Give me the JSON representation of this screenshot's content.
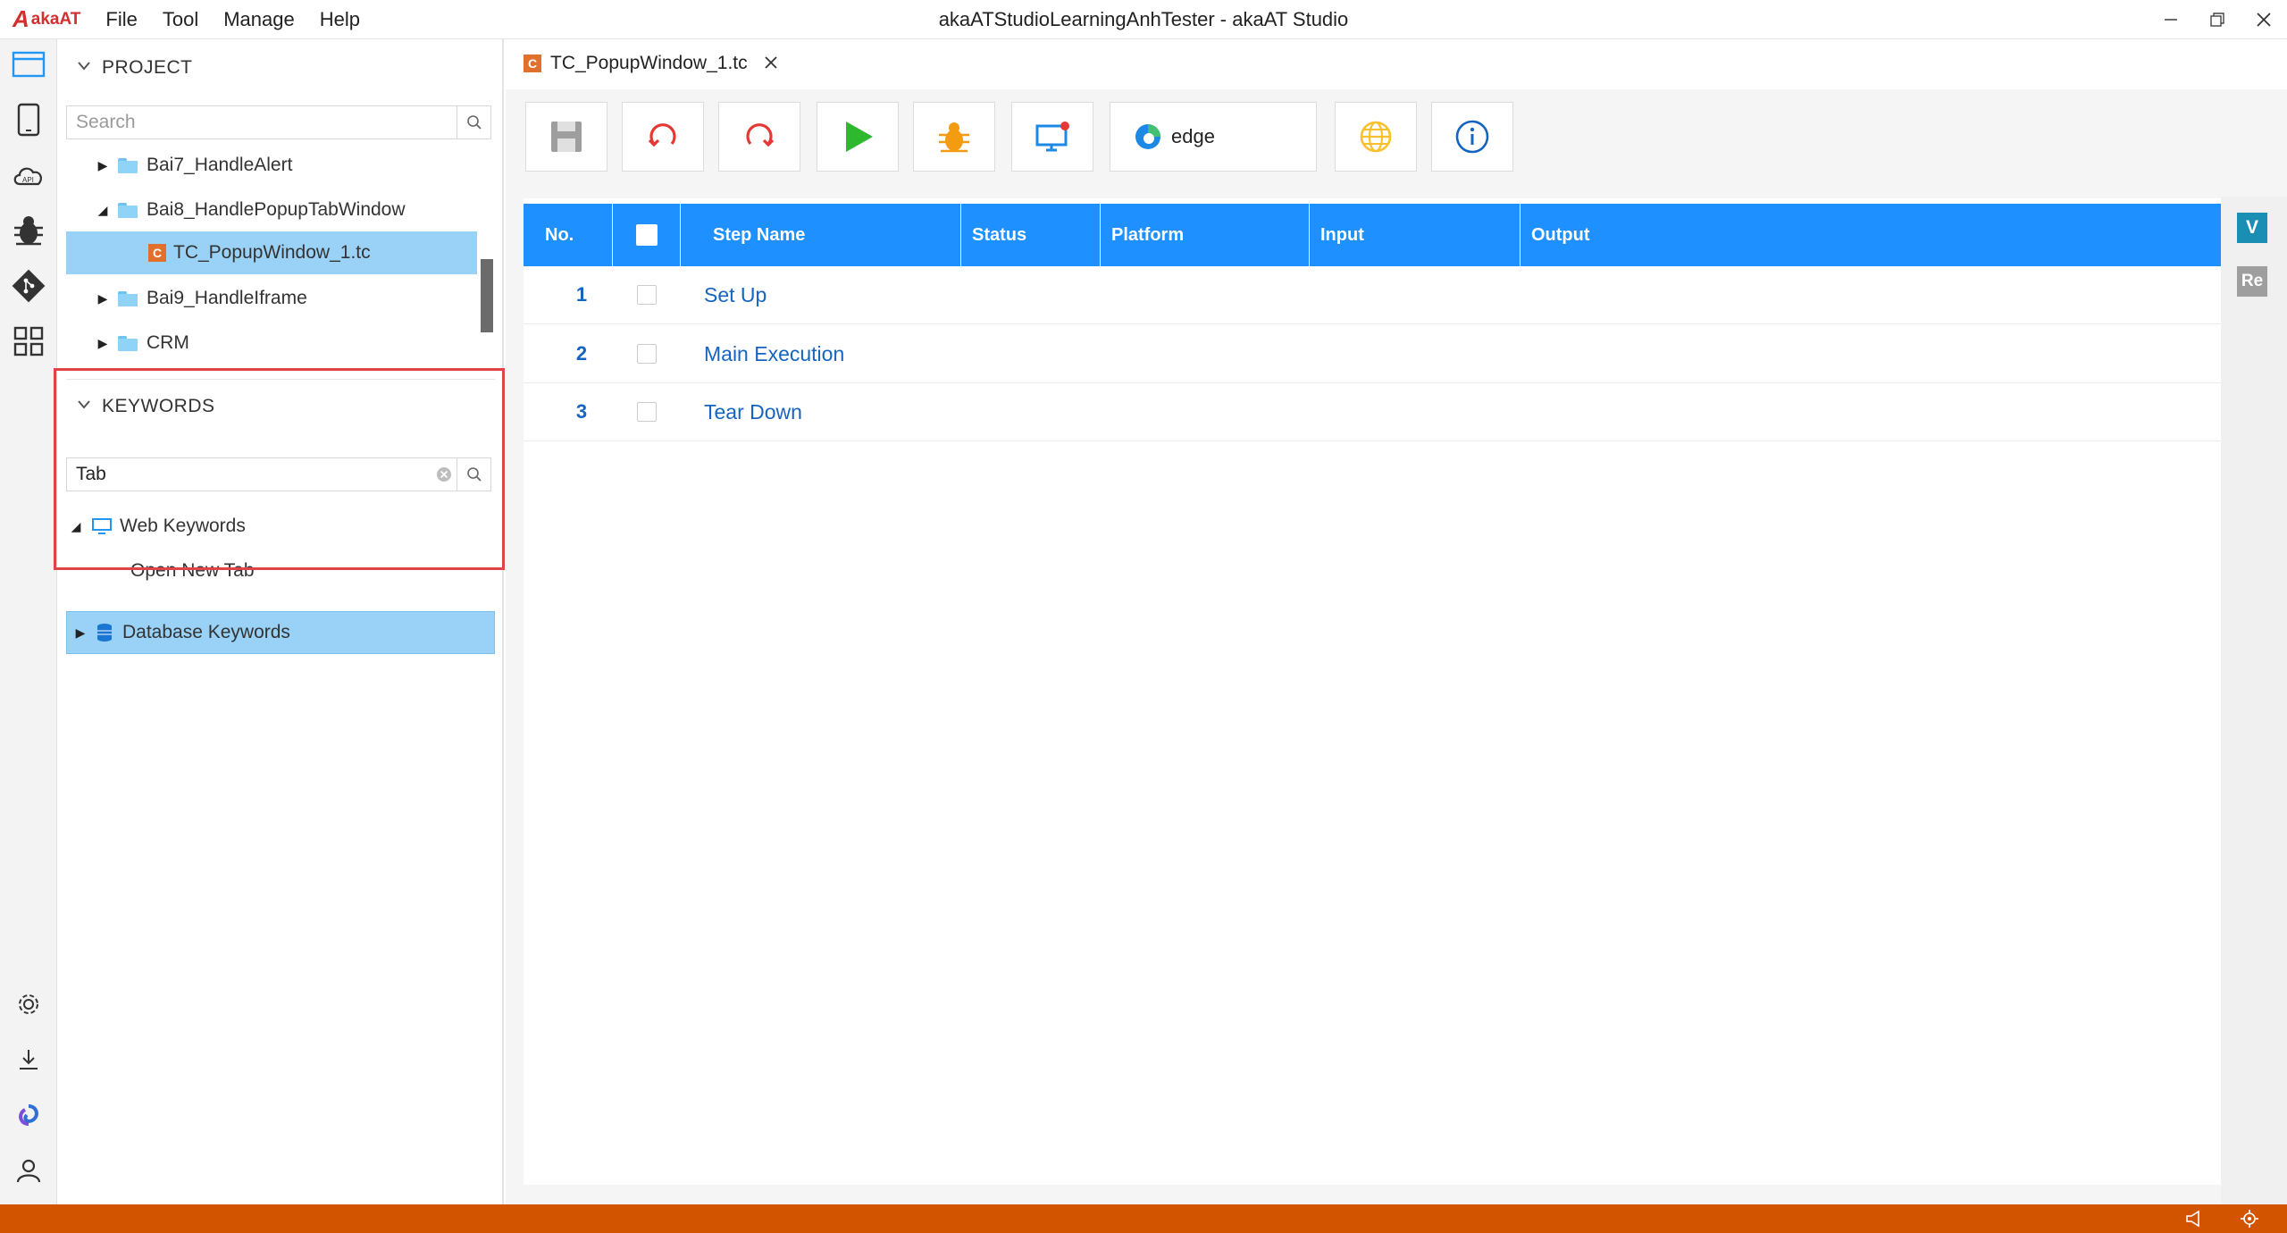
{
  "app": {
    "logo_text": "akaAT",
    "window_title": "akaATStudioLearningAnhTester - akaAT Studio",
    "menu": [
      "File",
      "Tool",
      "Manage",
      "Help"
    ]
  },
  "project": {
    "header": "PROJECT",
    "search_placeholder": "Search",
    "items": [
      {
        "label": "Bai7_HandleAlert"
      },
      {
        "label": "Bai8_HandlePopupTabWindow"
      },
      {
        "label": "TC_PopupWindow_1.tc"
      },
      {
        "label": "Bai9_HandleIframe"
      },
      {
        "label": "CRM"
      }
    ]
  },
  "keywords": {
    "header": "KEYWORDS",
    "search_value": "Tab",
    "groups": [
      {
        "label": "Web Keywords",
        "children": [
          "Open New Tab"
        ]
      },
      {
        "label": "Database Keywords"
      }
    ]
  },
  "editor": {
    "tab_label": "TC_PopupWindow_1.tc",
    "tc_badge": "C",
    "browser": "edge",
    "columns": [
      "No.",
      "Step Name",
      "Status",
      "Platform",
      "Input",
      "Output"
    ],
    "rows": [
      {
        "no": "1",
        "name": "Set Up"
      },
      {
        "no": "2",
        "name": "Main Execution"
      },
      {
        "no": "3",
        "name": "Tear Down"
      }
    ],
    "side_badges": [
      "V",
      "Re"
    ]
  },
  "colors": {
    "accent": "#1e90ff",
    "statusbar": "#d35400",
    "highlight": "#e0434a",
    "selection": "#99d1f7"
  }
}
